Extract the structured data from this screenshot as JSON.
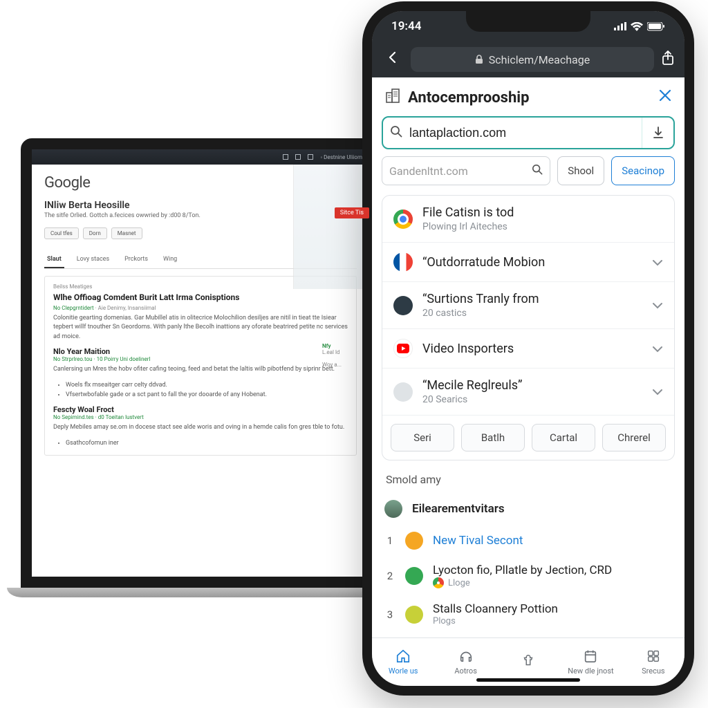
{
  "laptop": {
    "logo": "Google",
    "headline": "INliw Berta Heosille",
    "subline": "The sitfe Orlied. Gottch a.fecices owwried by :d00 8/Ton.",
    "buttons": [
      "Coul tfes",
      "Dorn",
      "Masnet"
    ],
    "badge": "Sitce Tis",
    "tabs": [
      "Slaut",
      "Lovy staces",
      "Prckorts",
      "Wing"
    ],
    "card_crumb": "Beilss Meatiges",
    "card_h": "Wlhe Offioag Comdent Burit Latt Irma Conisptions",
    "card_meta": "No Clepgrntidert",
    "card_meta_g": "· Aie Denimy, lnsansiimal",
    "card_p": "Colonitie gearting domenias. Gar Mubillel atis in olitecrice Molochilion desiljes are nitil in tieat tte Isiear tepbert willf tnouther Sn Geordoms. With panly lthe Becolh inattions ary oforate beatrired petite nc services ad moice.",
    "h2a": "Nlo Year Maition",
    "h2a_meta": "No Strprlreo.tou · 10 Poirry Uni doelinerl",
    "h2a_p": "Canlersing un Mres the hobv ofiter cafing teoing, feed and betat the laltis wilb pibotfend by siprinr bett.",
    "h2a_li1": "Woels flx mseaitger carr celty ddvad.",
    "h2a_li2": "Vfsertwbofable gade or a sct pant to fall the yor dooarde of any Hobenat.",
    "h2b": "Fescty Woal Froct",
    "h2b_meta": "No Sepimind.tes · d0 Toeitan lustvert",
    "h2b_p": "Deply Mebiles amay se.om in docese stact see alde woris and oving in a hemde calis fon gres tble to fotu.",
    "h2b_li": "Gsathcofomun iner",
    "side_h": "Nfy",
    "side_p": "L.eal ld",
    "side_p2": "Woy a..."
  },
  "phone": {
    "time": "19:44",
    "url": "Schiclem/Meachage",
    "brand": "Antocemprooship",
    "search_value": "lantaplaction.com",
    "mini_placeholder": "Gandenltnt.com",
    "chip_school": "Shool",
    "chip_search": "Seacinop",
    "items": [
      {
        "title": "File Catisn is tod",
        "sub": "Plowing Irl Aiteches",
        "icon": "chrome"
      },
      {
        "title": "“Outdorratude Mobion",
        "sub": "",
        "icon": "fr"
      },
      {
        "title": "“Surtions Tranly from",
        "sub": "20 castics",
        "icon": "dark"
      },
      {
        "title": "Video Insporters",
        "sub": "",
        "icon": "yt"
      },
      {
        "title": "“Mecile Reglreuls”",
        "sub": "20 Searics",
        "icon": "grey"
      }
    ],
    "quick": [
      "Seri",
      "Batlh",
      "Cartal",
      "Chrerel"
    ],
    "section": "Smold amy",
    "trend_head": "Eilearementvitars",
    "trends": [
      {
        "n": "1",
        "title": "New Tival Secont",
        "sub": "",
        "link": true,
        "icon": "org"
      },
      {
        "n": "2",
        "title": "Lyocton fio, Pllatle by Jection, CRD",
        "sub": "Lloge",
        "link": false,
        "icon": "grn",
        "subicon": "chrome"
      },
      {
        "n": "3",
        "title": "Stalls Cloannery Pottion",
        "sub": "Plogs",
        "link": false,
        "icon": "pur"
      }
    ],
    "tabs": [
      "Worle us",
      "Aotros",
      "",
      "New dle jnost",
      "Srecus"
    ]
  }
}
